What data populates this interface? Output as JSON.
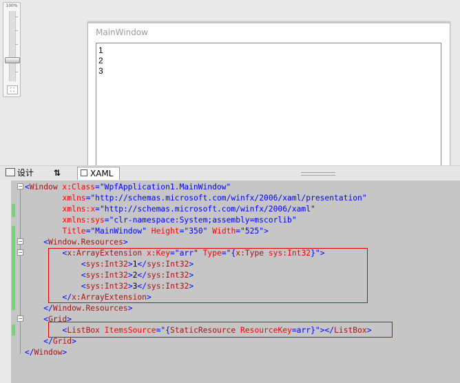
{
  "zoom": {
    "label": "100%"
  },
  "designer": {
    "window_title": "MainWindow",
    "listbox_items": [
      "1",
      "2",
      "3"
    ]
  },
  "tabs": {
    "design_label": "设计",
    "swap_label": "⇅",
    "xaml_label": "XAML"
  },
  "code_lines": [
    {
      "indent": 0,
      "parts": [
        {
          "c": "b",
          "t": "<"
        },
        {
          "c": "t",
          "t": "Window"
        },
        {
          "c": "a",
          "t": " x:Class"
        },
        {
          "c": "b",
          "t": "=\""
        },
        {
          "c": "v",
          "t": "WpfApplication1.MainWindow"
        },
        {
          "c": "b",
          "t": "\""
        }
      ]
    },
    {
      "indent": 8,
      "parts": [
        {
          "c": "a",
          "t": "xmlns"
        },
        {
          "c": "b",
          "t": "=\""
        },
        {
          "c": "v",
          "t": "http://schemas.microsoft.com/winfx/2006/xaml/presentation"
        },
        {
          "c": "b",
          "t": "\""
        }
      ]
    },
    {
      "indent": 8,
      "parts": [
        {
          "c": "a",
          "t": "xmlns:x"
        },
        {
          "c": "b",
          "t": "=\""
        },
        {
          "c": "v",
          "t": "http://schemas.microsoft.com/winfx/2006/xaml"
        },
        {
          "c": "b",
          "t": "\""
        }
      ]
    },
    {
      "indent": 8,
      "parts": [
        {
          "c": "a",
          "t": "xmlns:sys"
        },
        {
          "c": "b",
          "t": "=\""
        },
        {
          "c": "v",
          "t": "clr-namespace:System;assembly=mscorlib"
        },
        {
          "c": "b",
          "t": "\""
        }
      ]
    },
    {
      "indent": 8,
      "parts": [
        {
          "c": "a",
          "t": "Title"
        },
        {
          "c": "b",
          "t": "=\""
        },
        {
          "c": "v",
          "t": "MainWindow"
        },
        {
          "c": "b",
          "t": "\""
        },
        {
          "c": "a",
          "t": " Height"
        },
        {
          "c": "b",
          "t": "=\""
        },
        {
          "c": "v",
          "t": "350"
        },
        {
          "c": "b",
          "t": "\""
        },
        {
          "c": "a",
          "t": " Width"
        },
        {
          "c": "b",
          "t": "=\""
        },
        {
          "c": "v",
          "t": "525"
        },
        {
          "c": "b",
          "t": "\">"
        }
      ]
    },
    {
      "indent": 4,
      "parts": [
        {
          "c": "b",
          "t": "<"
        },
        {
          "c": "t",
          "t": "Window.Resources"
        },
        {
          "c": "b",
          "t": ">"
        }
      ]
    },
    {
      "indent": 8,
      "parts": [
        {
          "c": "b",
          "t": "<"
        },
        {
          "c": "t",
          "t": "x:ArrayExtension"
        },
        {
          "c": "a",
          "t": " x:Key"
        },
        {
          "c": "b",
          "t": "=\""
        },
        {
          "c": "v",
          "t": "arr"
        },
        {
          "c": "b",
          "t": "\""
        },
        {
          "c": "a",
          "t": " Type"
        },
        {
          "c": "b",
          "t": "=\""
        },
        {
          "c": "v",
          "t": "{"
        },
        {
          "c": "t",
          "t": "x:Type"
        },
        {
          "c": "a",
          "t": " sys:Int32"
        },
        {
          "c": "v",
          "t": "}"
        },
        {
          "c": "b",
          "t": "\">"
        }
      ]
    },
    {
      "indent": 12,
      "parts": [
        {
          "c": "b",
          "t": "<"
        },
        {
          "c": "t",
          "t": "sys:Int32"
        },
        {
          "c": "b",
          "t": ">"
        },
        {
          "c": "k",
          "t": "1"
        },
        {
          "c": "b",
          "t": "</"
        },
        {
          "c": "t",
          "t": "sys:Int32"
        },
        {
          "c": "b",
          "t": ">"
        }
      ]
    },
    {
      "indent": 12,
      "parts": [
        {
          "c": "b",
          "t": "<"
        },
        {
          "c": "t",
          "t": "sys:Int32"
        },
        {
          "c": "b",
          "t": ">"
        },
        {
          "c": "k",
          "t": "2"
        },
        {
          "c": "b",
          "t": "</"
        },
        {
          "c": "t",
          "t": "sys:Int32"
        },
        {
          "c": "b",
          "t": ">"
        }
      ]
    },
    {
      "indent": 12,
      "parts": [
        {
          "c": "b",
          "t": "<"
        },
        {
          "c": "t",
          "t": "sys:Int32"
        },
        {
          "c": "b",
          "t": ">"
        },
        {
          "c": "k",
          "t": "3"
        },
        {
          "c": "b",
          "t": "</"
        },
        {
          "c": "t",
          "t": "sys:Int32"
        },
        {
          "c": "b",
          "t": ">"
        }
      ]
    },
    {
      "indent": 8,
      "parts": [
        {
          "c": "b",
          "t": "</"
        },
        {
          "c": "t",
          "t": "x:ArrayExtension"
        },
        {
          "c": "b",
          "t": ">"
        }
      ]
    },
    {
      "indent": 4,
      "parts": [
        {
          "c": "b",
          "t": "</"
        },
        {
          "c": "t",
          "t": "Window.Resources"
        },
        {
          "c": "b",
          "t": ">"
        }
      ]
    },
    {
      "indent": 4,
      "parts": [
        {
          "c": "b",
          "t": "<"
        },
        {
          "c": "t",
          "t": "Grid"
        },
        {
          "c": "b",
          "t": ">"
        }
      ]
    },
    {
      "indent": 8,
      "parts": [
        {
          "c": "b",
          "t": "<"
        },
        {
          "c": "t",
          "t": "ListBox"
        },
        {
          "c": "a",
          "t": " ItemsSource"
        },
        {
          "c": "b",
          "t": "=\""
        },
        {
          "c": "v",
          "t": "{"
        },
        {
          "c": "t",
          "t": "StaticResource"
        },
        {
          "c": "a",
          "t": " ResourceKey"
        },
        {
          "c": "v",
          "t": "=arr}"
        },
        {
          "c": "b",
          "t": "\"></"
        },
        {
          "c": "t",
          "t": "ListBox"
        },
        {
          "c": "b",
          "t": ">"
        }
      ]
    },
    {
      "indent": 4,
      "parts": [
        {
          "c": "b",
          "t": "</"
        },
        {
          "c": "t",
          "t": "Grid"
        },
        {
          "c": "b",
          "t": ">"
        }
      ]
    },
    {
      "indent": 0,
      "parts": [
        {
          "c": "b",
          "t": "</"
        },
        {
          "c": "t",
          "t": "Window"
        },
        {
          "c": "b",
          "t": ">"
        }
      ]
    }
  ],
  "colors": {
    "tag_bracket": "#0000ff",
    "element_name": "#a31515",
    "attribute_name": "#ff0000",
    "attribute_value": "#0000ff",
    "content_text": "#000000",
    "highlight_box": "#e00000",
    "change_bar": "#6fd86f",
    "editor_background": "#c6c6c6"
  }
}
